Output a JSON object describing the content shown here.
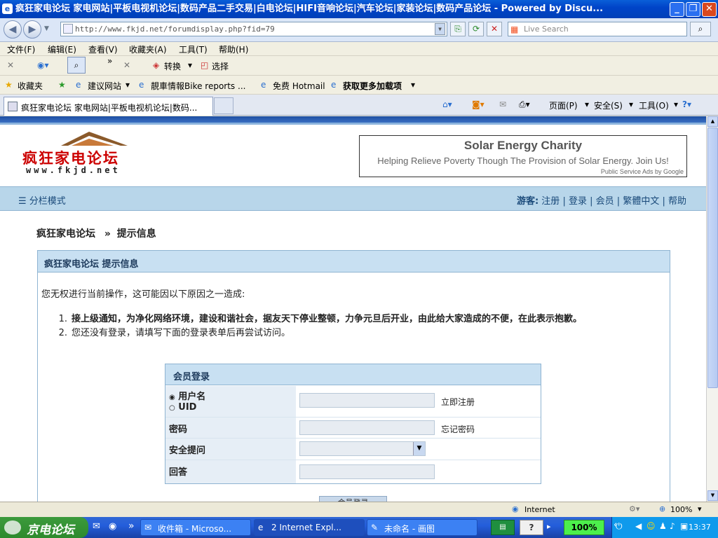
{
  "window": {
    "title": "疯狂家电论坛 家电网站|平板电视机论坛|数码产品二手交易|白电论坛|HIFI音响论坛|汽车论坛|家装论坛|数码产品论坛 - Powered by Discu...",
    "min": "_",
    "max": "❐",
    "close": "✕"
  },
  "address": {
    "url": "http://www.fkjd.net/forumdisplay.php?fid=79",
    "search_placeholder": "Live Search"
  },
  "menu": [
    "文件(F)",
    "编辑(E)",
    "查看(V)",
    "收藏夹(A)",
    "工具(T)",
    "帮助(H)"
  ],
  "toolbar": {
    "convert": "转换",
    "select": "选择"
  },
  "favorites": {
    "label": "收藏夹",
    "items": [
      "建议网站",
      "靚車情報Bike reports ...",
      "免费 Hotmail",
      "获取更多加载项"
    ]
  },
  "tab": {
    "title": "疯狂家电论坛 家电网站|平板电视机论坛|数码...",
    "page": "页面(P)",
    "safety": "安全(S)",
    "tools": "工具(O)"
  },
  "site": {
    "logo_cn": "疯狂家电论坛",
    "logo_url": "www.fkjd.net",
    "ad": {
      "title": "Solar Energy Charity",
      "text": "Helping Relieve Poverty Though The Provision of Solar Energy. Join Us!",
      "by": "Public Service Ads by Google"
    },
    "nav_left": "分栏模式",
    "guest_label": "游客:",
    "nav_links": [
      "注册",
      "登录",
      "会员",
      "繁體中文",
      "帮助"
    ]
  },
  "breadcrumb": {
    "home": "疯狂家电论坛",
    "sep": "»",
    "current": "提示信息"
  },
  "notice": {
    "header": "疯狂家电论坛 提示信息",
    "message": "您无权进行当前操作，这可能因以下原因之一造成:",
    "reasons": [
      {
        "n": "1.",
        "text": "接上级通知，为净化网络环境，建设和谐社会，据友天下停业整顿，力争元旦后开业，由此给大家造成的不便，在此表示抱歉。"
      },
      {
        "n": "2.",
        "text": "您还没有登录，请填写下面的登录表单后再尝试访问。"
      }
    ]
  },
  "login": {
    "header": "会员登录",
    "username_option": "用户名",
    "uid_option": "UID",
    "register_link": "立即注册",
    "password_label": "密码",
    "forgot_link": "忘记密码",
    "question_label": "安全提问",
    "answer_label": "回答",
    "submit": "会员登录"
  },
  "status": {
    "zone": "Internet",
    "zoom": "100%"
  },
  "taskbar": {
    "start": "京电论坛",
    "tasks": [
      "收件箱 - Microso...",
      "2 Internet Expl...",
      "未命名 - 画图"
    ],
    "battery": "100%",
    "clock": "13:37"
  }
}
